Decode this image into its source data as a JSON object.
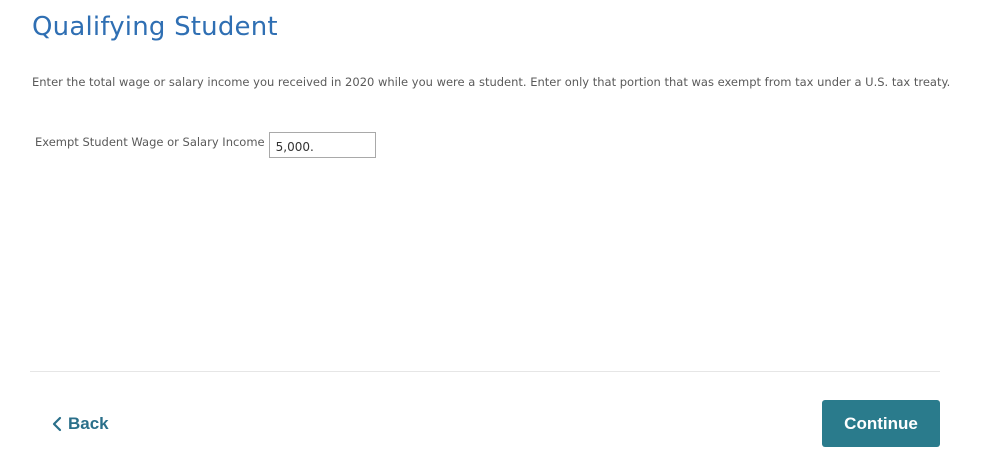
{
  "page": {
    "title": "Qualifying Student",
    "instructions": "Enter the total wage or salary income you received in 2020 while you were a student. Enter only that portion that was exempt from tax under a U.S. tax treaty."
  },
  "form": {
    "field_label": "Exempt Student Wage or Salary Income",
    "field_value": "5,000."
  },
  "footer": {
    "back_label": "Back",
    "back_icon": "chevron-left-icon",
    "continue_label": "Continue"
  },
  "colors": {
    "title": "#2f6fb3",
    "accent": "#2a7b8c",
    "back_text": "#2a6f8a"
  }
}
